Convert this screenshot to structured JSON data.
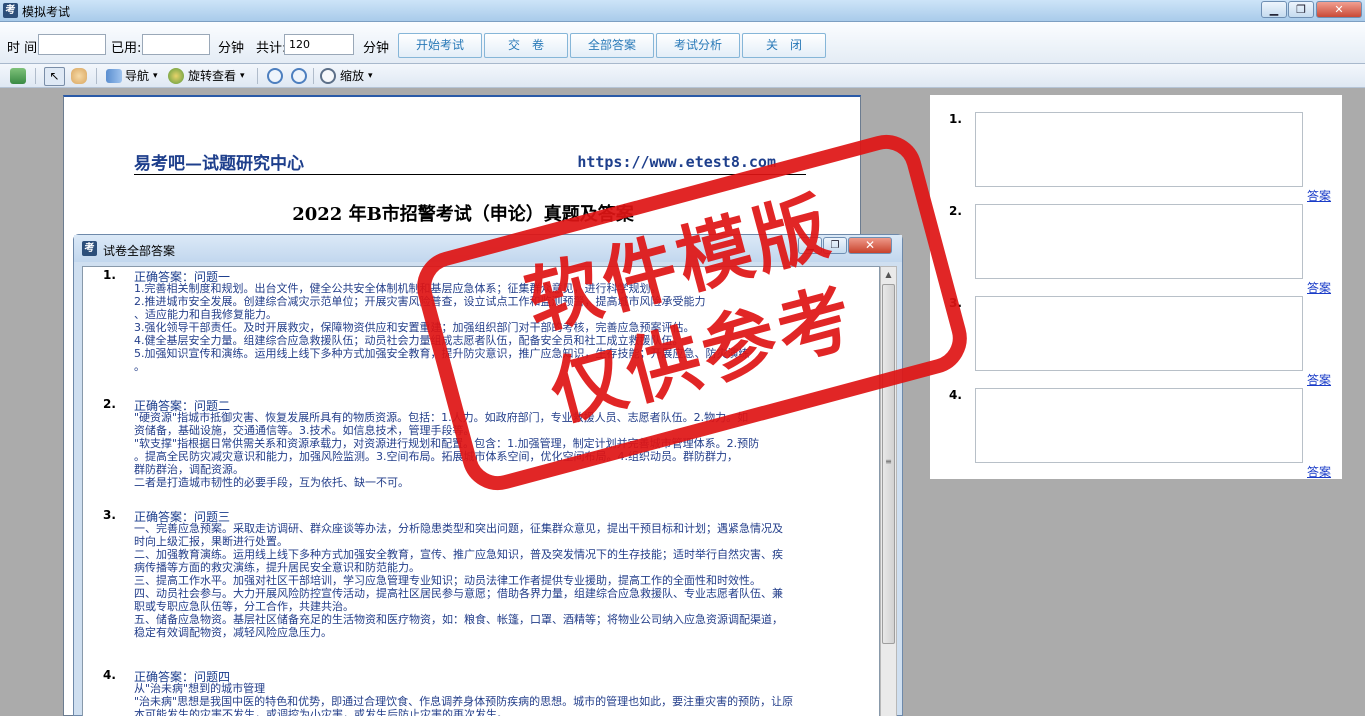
{
  "window": {
    "title": "模拟考试",
    "app_icon": "考",
    "controls": [
      "▁",
      "❐",
      "✕"
    ]
  },
  "toolbar": {
    "time_label": "时 间:",
    "time_value": "",
    "used_label": "已用:",
    "used_value": "",
    "min_label_1": "分钟",
    "total_label": "共计:",
    "total_value": "120",
    "min_label_2": "分钟",
    "buttons": [
      "开始考试",
      "交　卷",
      "全部答案",
      "考试分析",
      "关　闭"
    ]
  },
  "viewer_toolbar": {
    "nav_label": "导航",
    "rotate_label": "旋转查看",
    "zoom_label": "缩放",
    "dropdown_glyph": "▾"
  },
  "document": {
    "header_left": "易考吧—试题研究中心",
    "header_right": "https://www.etest8.com",
    "title": "2022 年B市招警考试（申论）真题及答案"
  },
  "answer_panel": {
    "items": [
      {
        "num": "1.",
        "link": "答案"
      },
      {
        "num": "2.",
        "link": "答案"
      },
      {
        "num": "3.",
        "link": "答案"
      },
      {
        "num": "4.",
        "link": "答案"
      }
    ]
  },
  "dialog": {
    "title": "试卷全部答案",
    "icon": "考",
    "controls": [
      "▁",
      "❐",
      "✕"
    ],
    "scroll_up": "▲",
    "scroll_grip": "≡",
    "questions": [
      {
        "num": "1.",
        "header": "正确答案：问题一",
        "lines": [
          "1.完善相关制度和规划。出台文件，健全公共安全体制机制和基层应急体系；征集群众意见，进行科学规划。",
          "2.推进城市安全发展。创建综合减灾示范单位；开展灾害风险普查，设立试点工作和监测预警，提高城市风险承受能力",
          "、适应能力和自我修复能力。",
          "3.强化领导干部责任。及时开展救灾，保障物资供应和安置重建；加强组织部门对干部的考核，完善应急预案评估。",
          "4.健全基层安全力量。组建综合应急救援队伍；动员社会力量组成志愿者队伍，配备安全员和社工成立救援队伍。",
          "5.加强知识宣传和演练。运用线上线下多种方式加强安全教育，提升防灾意识，推广应急知识，生存技能；开展应急、防灾演练",
          "。"
        ]
      },
      {
        "num": "2.",
        "header": "正确答案：问题二",
        "lines": [
          "\"硬资源\"指城市抵御灾害、恢复发展所具有的物质资源。包括：1.人力。如政府部门，专业救援人员、志愿者队伍。2.物力。如",
          "资储备，基础设施，交通通信等。3.技术。如信息技术，管理手段等。",
          "\"软支撑\"指根据日常供需关系和资源承载力，对资源进行规划和配置。包含：1.加强管理，制定计划并完善城市管理体系。2.预防",
          "。提高全民防灾减灾意识和能力，加强风险监测。3.空间布局。拓展城市体系空间，优化空间布局。4.组织动员。群防群力，",
          "群防群治，调配资源。",
          "二者是打造城市韧性的必要手段，互为依托、缺一不可。"
        ]
      },
      {
        "num": "3.",
        "header": "正确答案：问题三",
        "lines": [
          "一、完善应急预案。采取走访调研、群众座谈等办法，分析隐患类型和突出问题，征集群众意见，提出干预目标和计划；遇紧急情况及",
          "时向上级汇报，果断进行处置。",
          "二、加强教育演练。运用线上线下多种方式加强安全教育，宣传、推广应急知识，普及突发情况下的生存技能；适时举行自然灾害、疾",
          "病传播等方面的救灾演练，提升居民安全意识和防范能力。",
          "三、提高工作水平。加强对社区干部培训，学习应急管理专业知识；动员法律工作者提供专业援助，提高工作的全面性和时效性。",
          "四、动员社会参与。大力开展风险防控宣传活动，提高社区居民参与意愿；借助各界力量，组建综合应急救援队、专业志愿者队伍、兼",
          "职或专职应急队伍等，分工合作，共建共治。",
          "五、储备应急物资。基层社区储备充足的生活物资和医疗物资，如：粮食、帐篷，口罩、酒精等；将物业公司纳入应急资源调配渠道，",
          "稳定有效调配物资，减轻风险应急压力。"
        ]
      },
      {
        "num": "4.",
        "header": "正确答案：问题四",
        "lines": [
          "从\"治未病\"想到的城市管理",
          "\"治未病\"思想是我国中医的特色和优势，即通过合理饮食、作息调养身体预防疾病的思想。城市的管理也如此，要注重灾害的预防，让原",
          "本可能发生的灾害不发生，或调控为小灾害，或发生后防止灾害的再次发生。"
        ]
      }
    ]
  },
  "watermark": {
    "line1": "软件模版",
    "line2": "仅供参考"
  },
  "colors": {
    "accent": "#2a7ab8",
    "answer_text": "#233e8a",
    "link": "#1a3cc8",
    "stamp": "#de1414"
  }
}
